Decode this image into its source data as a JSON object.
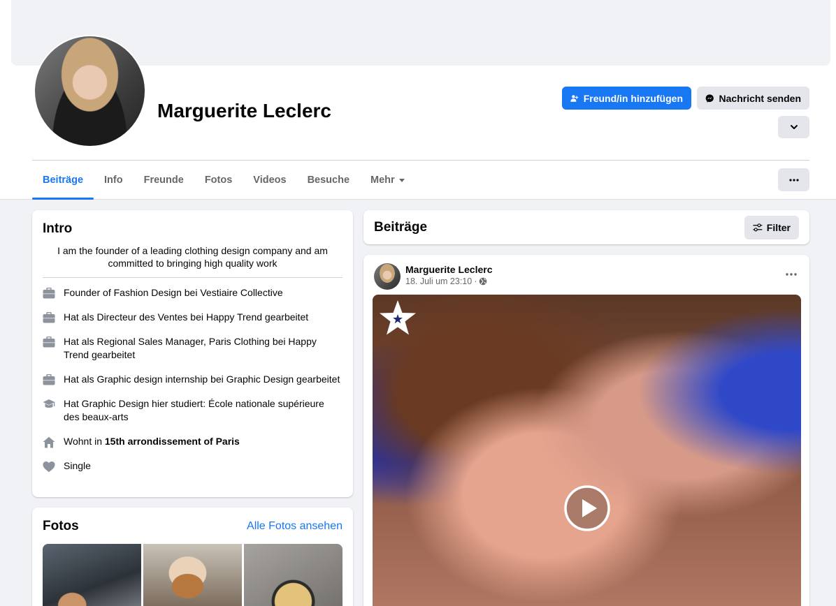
{
  "profile": {
    "name": "Marguerite Leclerc",
    "add_friend_label": "Freund/in hinzufügen",
    "message_label": "Nachricht senden"
  },
  "tabs": [
    {
      "label": "Beiträge",
      "active": true
    },
    {
      "label": "Info"
    },
    {
      "label": "Freunde"
    },
    {
      "label": "Fotos"
    },
    {
      "label": "Videos"
    },
    {
      "label": "Besuche"
    },
    {
      "label": "Mehr"
    }
  ],
  "intro": {
    "title": "Intro",
    "bio": "I am the founder of a leading clothing design company and am committed to bringing high quality work",
    "items": [
      {
        "icon": "briefcase-icon",
        "text": "Founder of Fashion Design bei Vestiaire Collective"
      },
      {
        "icon": "briefcase-icon",
        "text": "Hat als Directeur des Ventes bei Happy Trend gearbeitet"
      },
      {
        "icon": "briefcase-icon",
        "text": "Hat als Regional Sales Manager, Paris Clothing bei Happy Trend gearbeitet"
      },
      {
        "icon": "briefcase-icon",
        "text": "Hat als Graphic design internship bei Graphic Design gearbeitet"
      },
      {
        "icon": "graduation-cap-icon",
        "text": "Hat Graphic Design hier studiert: École nationale supérieure des beaux-arts"
      },
      {
        "icon": "home-icon",
        "text_prefix": "Wohnt in ",
        "text_bold": "15th arrondissement of Paris"
      },
      {
        "icon": "heart-icon",
        "text": "Single"
      }
    ]
  },
  "photos": {
    "title": "Fotos",
    "see_all_label": "Alle Fotos ansehen"
  },
  "posts": {
    "title": "Beiträge",
    "filter_label": "Filter",
    "post": {
      "author": "Marguerite Leclerc",
      "timestamp": "18. Juli um 23:10",
      "separator": "·",
      "privacy_icon": "globe-icon"
    }
  },
  "colors": {
    "accent": "#1877f2",
    "secondary_button": "#e4e6eb",
    "page_background": "#f0f2f5",
    "muted_text": "#65676b"
  }
}
